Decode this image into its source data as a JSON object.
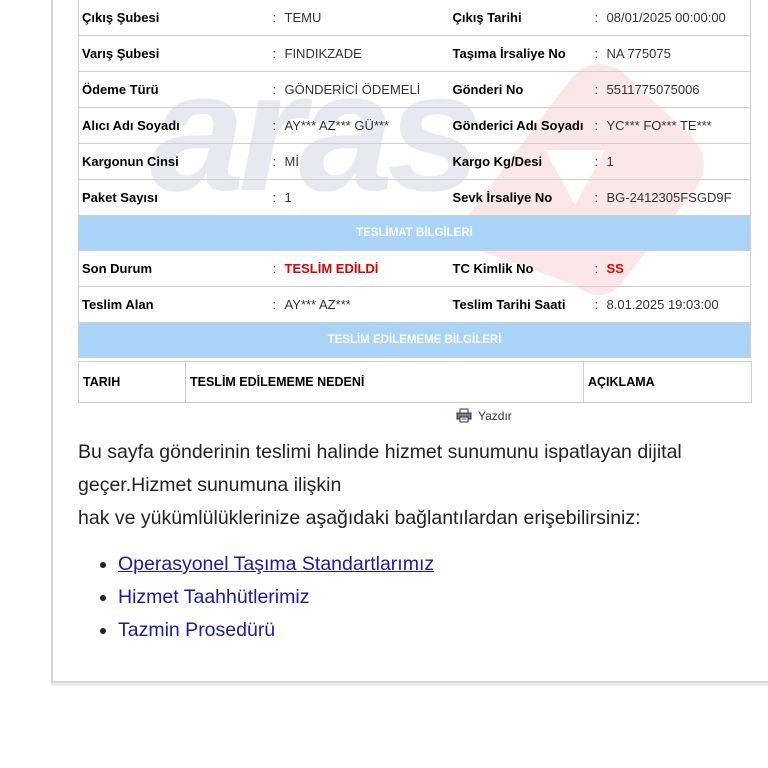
{
  "shipment": {
    "rows": [
      {
        "l1": "Çıkış Şubesi",
        "v1": "TEMU",
        "l2": "Çıkış Tarihi",
        "v2": "08/01/2025 00:00:00"
      },
      {
        "l1": "Varış Şubesi",
        "v1": "FINDIKZADE",
        "l2": "Taşıma İrsaliye No",
        "v2": "NA 775075"
      },
      {
        "l1": "Ödeme Türü",
        "v1": "GÖNDERİCİ ÖDEMELİ",
        "l2": "Gönderi No",
        "v2": "5511775075006"
      },
      {
        "l1": "Alıcı Adı Soyadı",
        "v1": "AY*** AZ*** GÜ***",
        "l2": "Gönderici Adı Soyadı",
        "v2": "YC*** FO*** TE***"
      },
      {
        "l1": "Kargonun Cinsi",
        "v1": "Mİ",
        "l2": "Kargo Kg/Desi",
        "v2": "1"
      },
      {
        "l1": "Paket Sayısı",
        "v1": "1",
        "l2": "Sevk İrsaliye No",
        "v2": "BG-2412305FSGD9F"
      }
    ]
  },
  "delivery": {
    "title": "TESLİMAT BİLGİLERİ",
    "rows": [
      {
        "l1": "Son Durum",
        "v1": "TESLİM EDİLDİ",
        "l2": "TC Kimlik No",
        "v2": "SS"
      },
      {
        "l1": "Teslim Alan",
        "v1": "AY*** AZ***",
        "l2": "Teslim Tarihi Saati",
        "v2": "8.01.2025 19:03:00"
      }
    ]
  },
  "failed": {
    "title": "TESLİM EDİLEMEME BİLGİLERİ",
    "headers": [
      "TARIH",
      "TESLİM EDİLEMEME NEDENİ",
      "AÇIKLAMA"
    ]
  },
  "colon": ":",
  "print_label": "Yazdır",
  "info_lines": [
    "Bu sayfa gönderinin teslimi halinde hizmet sunumunu ispatlayan dijital",
    "geçer.Hizmet sunumuna ilişkin",
    "hak ve yükümlülüklerinize aşağıdaki bağlantılardan erişebilirsiniz:"
  ],
  "links": [
    "Operasyonel Taşıma Standartlarımız",
    "Hizmet Taahhütlerimiz",
    "Tazmin Prosedürü"
  ],
  "colors": {
    "section_header": "#a9d3f7",
    "status_red": "#e00000",
    "link": "#1a1aa6"
  }
}
